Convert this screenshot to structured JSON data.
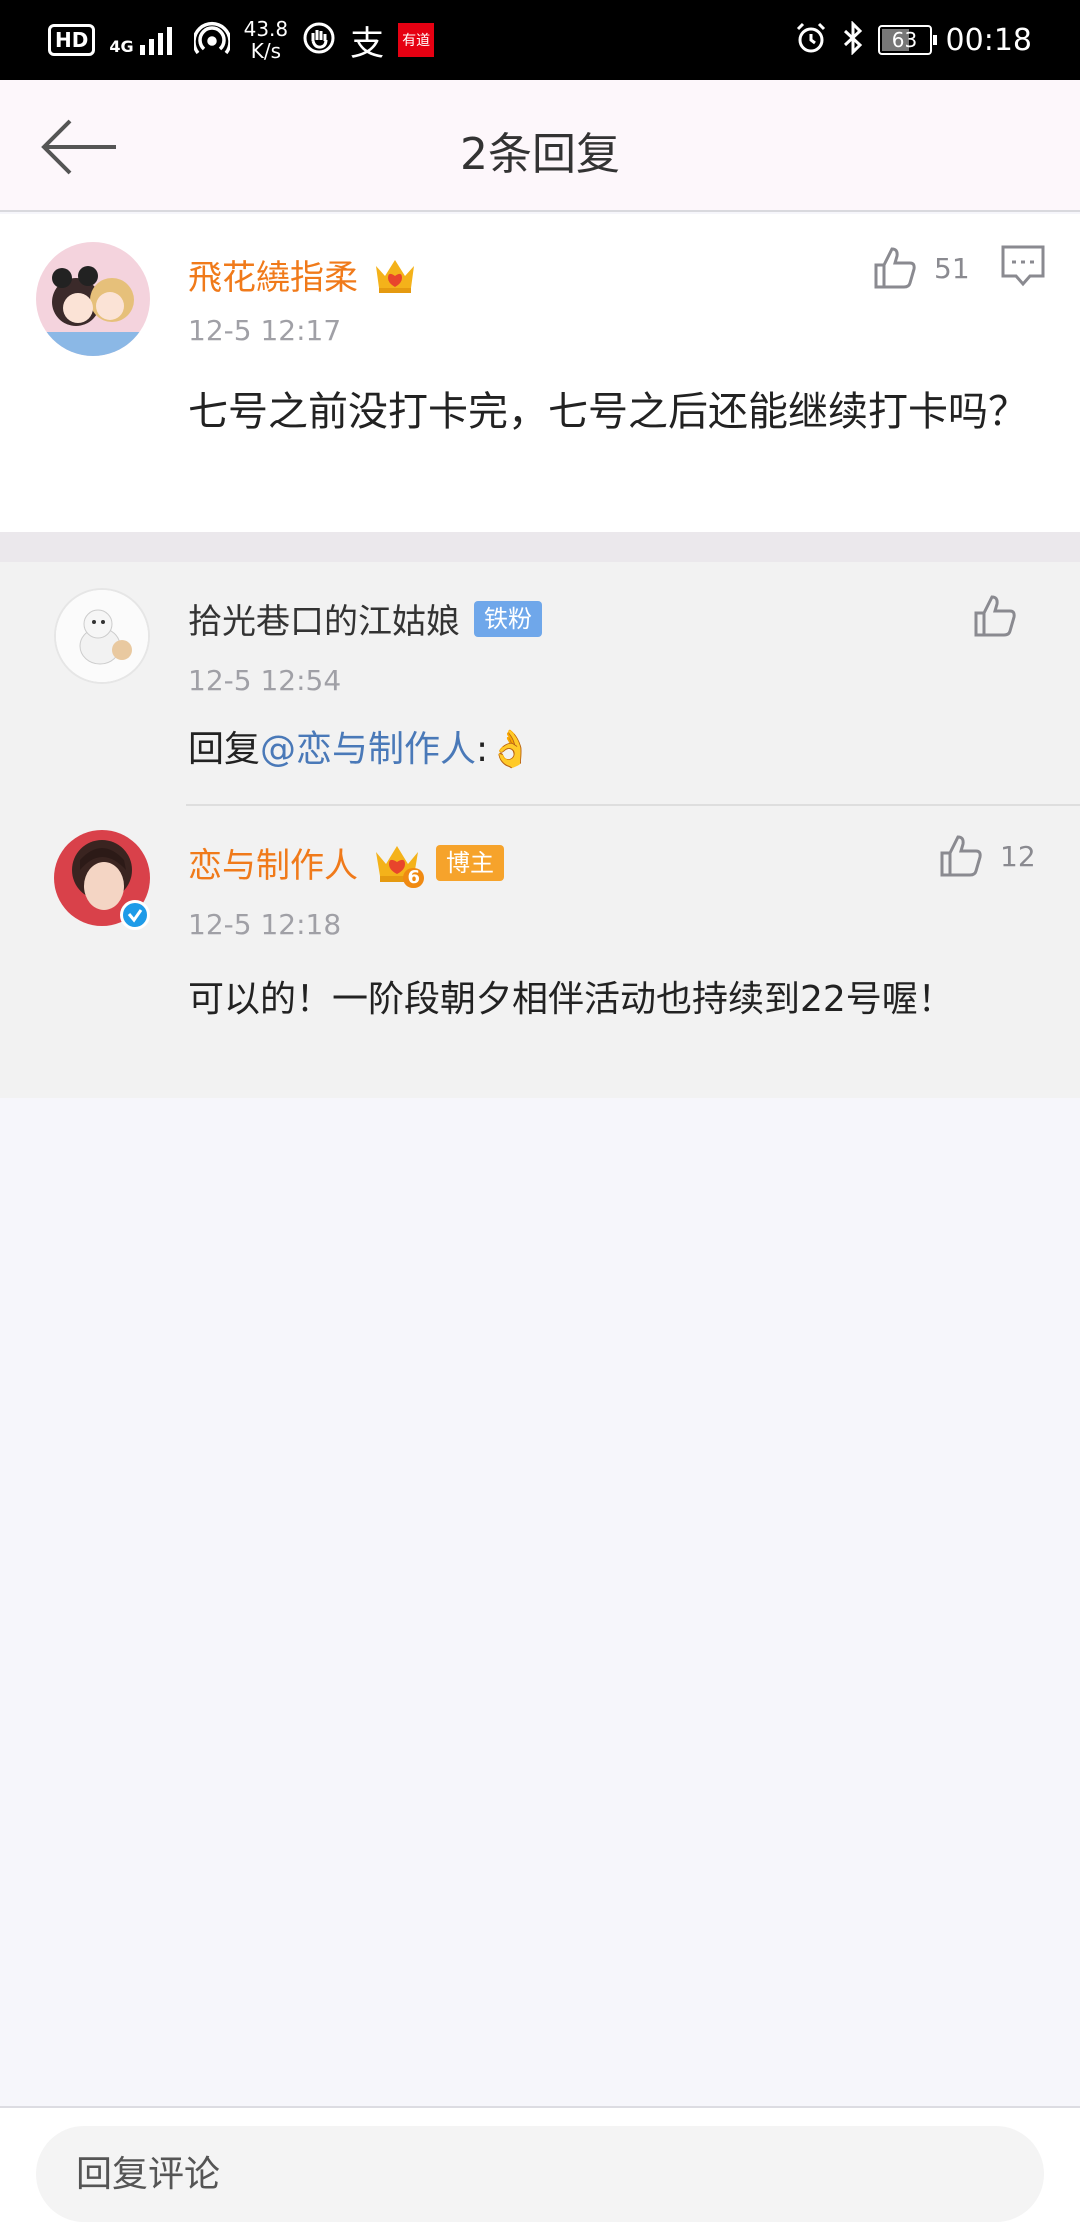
{
  "status_bar": {
    "hd": "HD",
    "network": "4G",
    "speed_value": "43.8",
    "speed_unit": "K/s",
    "alipay_glyph": "支",
    "youdao_label": "有道",
    "battery": "63",
    "battery_level": 0.63,
    "time": "00:18",
    "icons": [
      "signal-icon",
      "hotspot-icon",
      "hand-icon",
      "alipay-icon",
      "youdao-icon",
      "alarm-icon",
      "bluetooth-icon",
      "battery-icon"
    ]
  },
  "header": {
    "title": "2条回复",
    "back_icon": "arrow-left-icon"
  },
  "main_comment": {
    "username": "飛花繞指柔",
    "timestamp": "12-5 12:17",
    "text": "七号之前没打卡完，七号之后还能继续打卡吗？",
    "likes": "51",
    "icons": [
      "thumbs-up-icon",
      "comment-icon",
      "crown-icon"
    ]
  },
  "replies": [
    {
      "username": "拾光巷口的江姑娘",
      "badge": "铁粉",
      "timestamp": "12-5 12:54",
      "reply_prefix": "回复",
      "mention": "@恋与制作人",
      "colon": ":",
      "emoji": "👌",
      "likes": ""
    },
    {
      "username": "恋与制作人",
      "badge": "博主",
      "crown_level": "6",
      "timestamp": "12-5 12:18",
      "text": "可以的！一阶段朝夕相伴活动也持续到22号喔！",
      "likes": "12"
    }
  ],
  "bottom": {
    "placeholder": "回复评论"
  },
  "colors": {
    "accent_orange": "#f07a1a",
    "mention_blue": "#4a79b8",
    "badge_blue": "#6fa7ea",
    "badge_orange": "#f6a32b"
  }
}
